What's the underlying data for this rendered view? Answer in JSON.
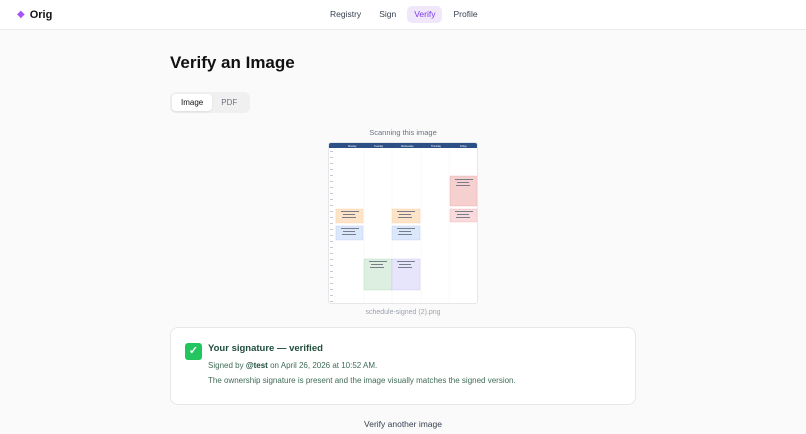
{
  "brand": {
    "name": "Orig",
    "icon": "diamond-logo-icon",
    "accent": "#a855f7"
  },
  "nav": {
    "items": [
      {
        "label": "Registry",
        "active": false
      },
      {
        "label": "Sign",
        "active": false
      },
      {
        "label": "Verify",
        "active": true
      },
      {
        "label": "Profile",
        "active": false
      }
    ]
  },
  "page": {
    "title": "Verify an Image"
  },
  "tabs": [
    {
      "label": "Image",
      "active": true
    },
    {
      "label": "PDF",
      "active": false
    }
  ],
  "preview": {
    "label": "Scanning this image",
    "filename": "schedule-signed (2).png",
    "schedule": {
      "days": [
        "Monday",
        "Tuesday",
        "Wednesday",
        "Thursday",
        "Friday"
      ]
    }
  },
  "result": {
    "icon": "check-mark-icon",
    "title": "Your signature — verified",
    "signed_prefix": "Signed by ",
    "signer": "@test",
    "signed_suffix": " on April 26, 2026 at 10:52 AM.",
    "message": "The ownership signature is present and the image visually matches the signed version.",
    "status_color": "#22c55e"
  },
  "actions": {
    "verify_another": "Verify another image"
  }
}
